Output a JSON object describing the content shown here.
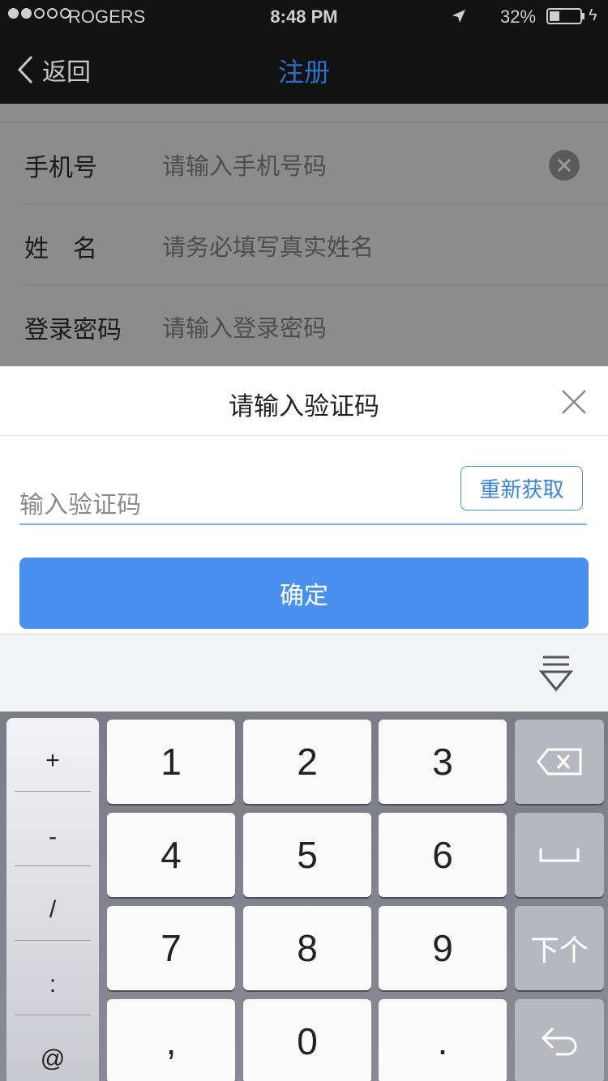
{
  "status_bar": {
    "carrier": "ROGERS",
    "time": "8:48 PM",
    "battery": "32%"
  },
  "nav": {
    "back_label": "返回",
    "title": "注册"
  },
  "form": {
    "rows": [
      {
        "label": "手机号",
        "placeholder": "请输入手机号码"
      },
      {
        "label": "姓　名",
        "placeholder": "请务必填写真实姓名"
      },
      {
        "label": "登录密码",
        "placeholder": "请输入登录密码"
      }
    ]
  },
  "modal": {
    "title": "请输入验证码",
    "input_placeholder": "输入验证码",
    "resend_label": "重新获取",
    "confirm_label": "确定"
  },
  "keyboard": {
    "symbols": [
      "+",
      "-",
      "/",
      ":",
      "@"
    ],
    "keys": [
      "1",
      "2",
      "3",
      "4",
      "5",
      "6",
      "7",
      "8",
      "9",
      ",",
      "0",
      "."
    ],
    "next_label": "下个"
  }
}
